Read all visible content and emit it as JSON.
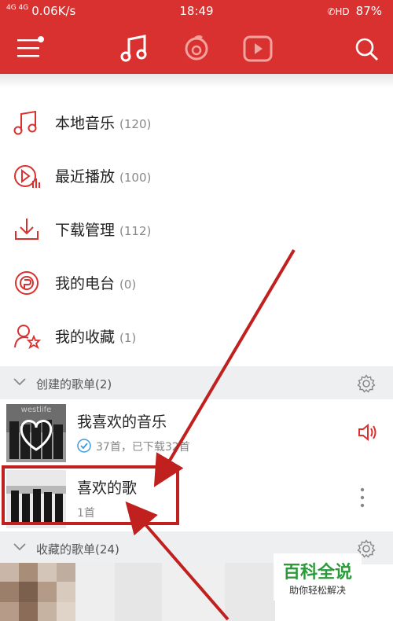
{
  "status": {
    "network": "4G 4G",
    "speed": "0.06K/s",
    "time": "18:49",
    "battery": "87%"
  },
  "toolbar": {
    "menu_icon": "menu-icon",
    "tabs": [
      "music-note-icon",
      "netease-radio-icon",
      "video-play-icon"
    ],
    "search_icon": "search-icon"
  },
  "menu": [
    {
      "label": "本地音乐",
      "count": "(120)",
      "icon": "music-note-icon"
    },
    {
      "label": "最近播放",
      "count": "(100)",
      "icon": "recent-play-icon"
    },
    {
      "label": "下载管理",
      "count": "(112)",
      "icon": "download-icon"
    },
    {
      "label": "我的电台",
      "count": "(0)",
      "icon": "radio-icon"
    },
    {
      "label": "我的收藏",
      "count": "(1)",
      "icon": "favorite-user-star-icon"
    }
  ],
  "created_section": {
    "label": "创建的歌单(2)"
  },
  "playlists": [
    {
      "title": "我喜欢的音乐",
      "subtitle": "37首，已下载32首",
      "cover_text": "westlife"
    },
    {
      "title": "喜欢的歌",
      "subtitle": "1首"
    }
  ],
  "collected_section": {
    "label": "收藏的歌单(24)"
  },
  "watermark": {
    "title": "百科全说",
    "subtitle": "助你轻松解决"
  },
  "colors": {
    "brand": "#d9312f",
    "annotation": "#c0201e",
    "watermark_green": "#2c9a3a"
  }
}
